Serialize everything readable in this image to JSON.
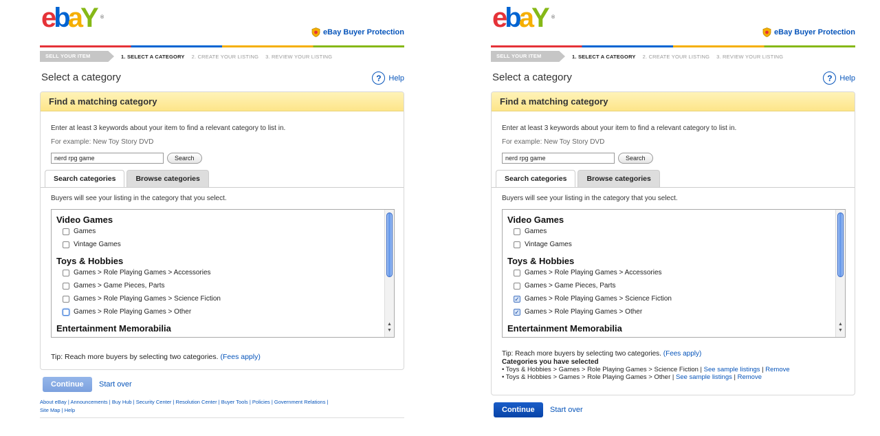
{
  "logo": {
    "letters": [
      "e",
      "b",
      "a",
      "Y"
    ],
    "reg": "®"
  },
  "buyer_protection": "eBay Buyer Protection",
  "steps": {
    "sell": "SELL YOUR ITEM",
    "s1": "1. SELECT A CATEGORY",
    "s2": "2. CREATE YOUR LISTING",
    "s3": "3. REVIEW YOUR LISTING"
  },
  "page_title": "Select a category",
  "help_icon": "?",
  "help": "Help",
  "box_title": "Find a matching category",
  "instructions": "Enter at least 3 keywords about your item to find a relevant category to list in.",
  "example": "For example: New Toy Story DVD",
  "keyword_value": "nerd rpg game",
  "search_label": "Search",
  "tabs": {
    "search": "Search categories",
    "browse": "Browse categories"
  },
  "list_note": "Buyers will see your listing in the category that you select.",
  "groups": {
    "video_games": {
      "title": "Video Games",
      "items": [
        "Games",
        "Vintage Games"
      ]
    },
    "toys": {
      "title": "Toys & Hobbies",
      "items": [
        "Games > Role Playing Games > Accessories",
        "Games > Game Pieces, Parts",
        "Games > Role Playing Games > Science Fiction",
        "Games > Role Playing Games > Other"
      ]
    },
    "memorabilia": {
      "title": "Entertainment Memorabilia"
    }
  },
  "tip": "Tip: Reach more buyers by selecting two categories.",
  "fees": "(Fees apply)",
  "selected": {
    "title": "Categories you have selected",
    "rows": [
      {
        "path": "Toys & Hobbies > Games > Role Playing Games > Science Fiction",
        "sample": "See sample listings",
        "remove": "Remove"
      },
      {
        "path": "Toys & Hobbies > Games > Role Playing Games > Other",
        "sample": "See sample listings",
        "remove": "Remove"
      }
    ]
  },
  "continue": "Continue",
  "start_over": "Start over",
  "footer": {
    "links": [
      "About eBay",
      "Announcements",
      "Buy Hub",
      "Security Center",
      "Resolution Center",
      "Buyer Tools",
      "Policies",
      "Government Relations",
      "Site Map",
      "Help"
    ]
  },
  "colors": {
    "blue": "#0654ba",
    "yellow": "#fde58a",
    "red": "#e53238",
    "green": "#86b817",
    "gold": "#f5af02"
  },
  "state": {
    "left_checked": [
      false,
      false,
      false,
      false,
      false,
      false
    ],
    "right_checked": [
      false,
      false,
      false,
      false,
      true,
      true
    ]
  }
}
